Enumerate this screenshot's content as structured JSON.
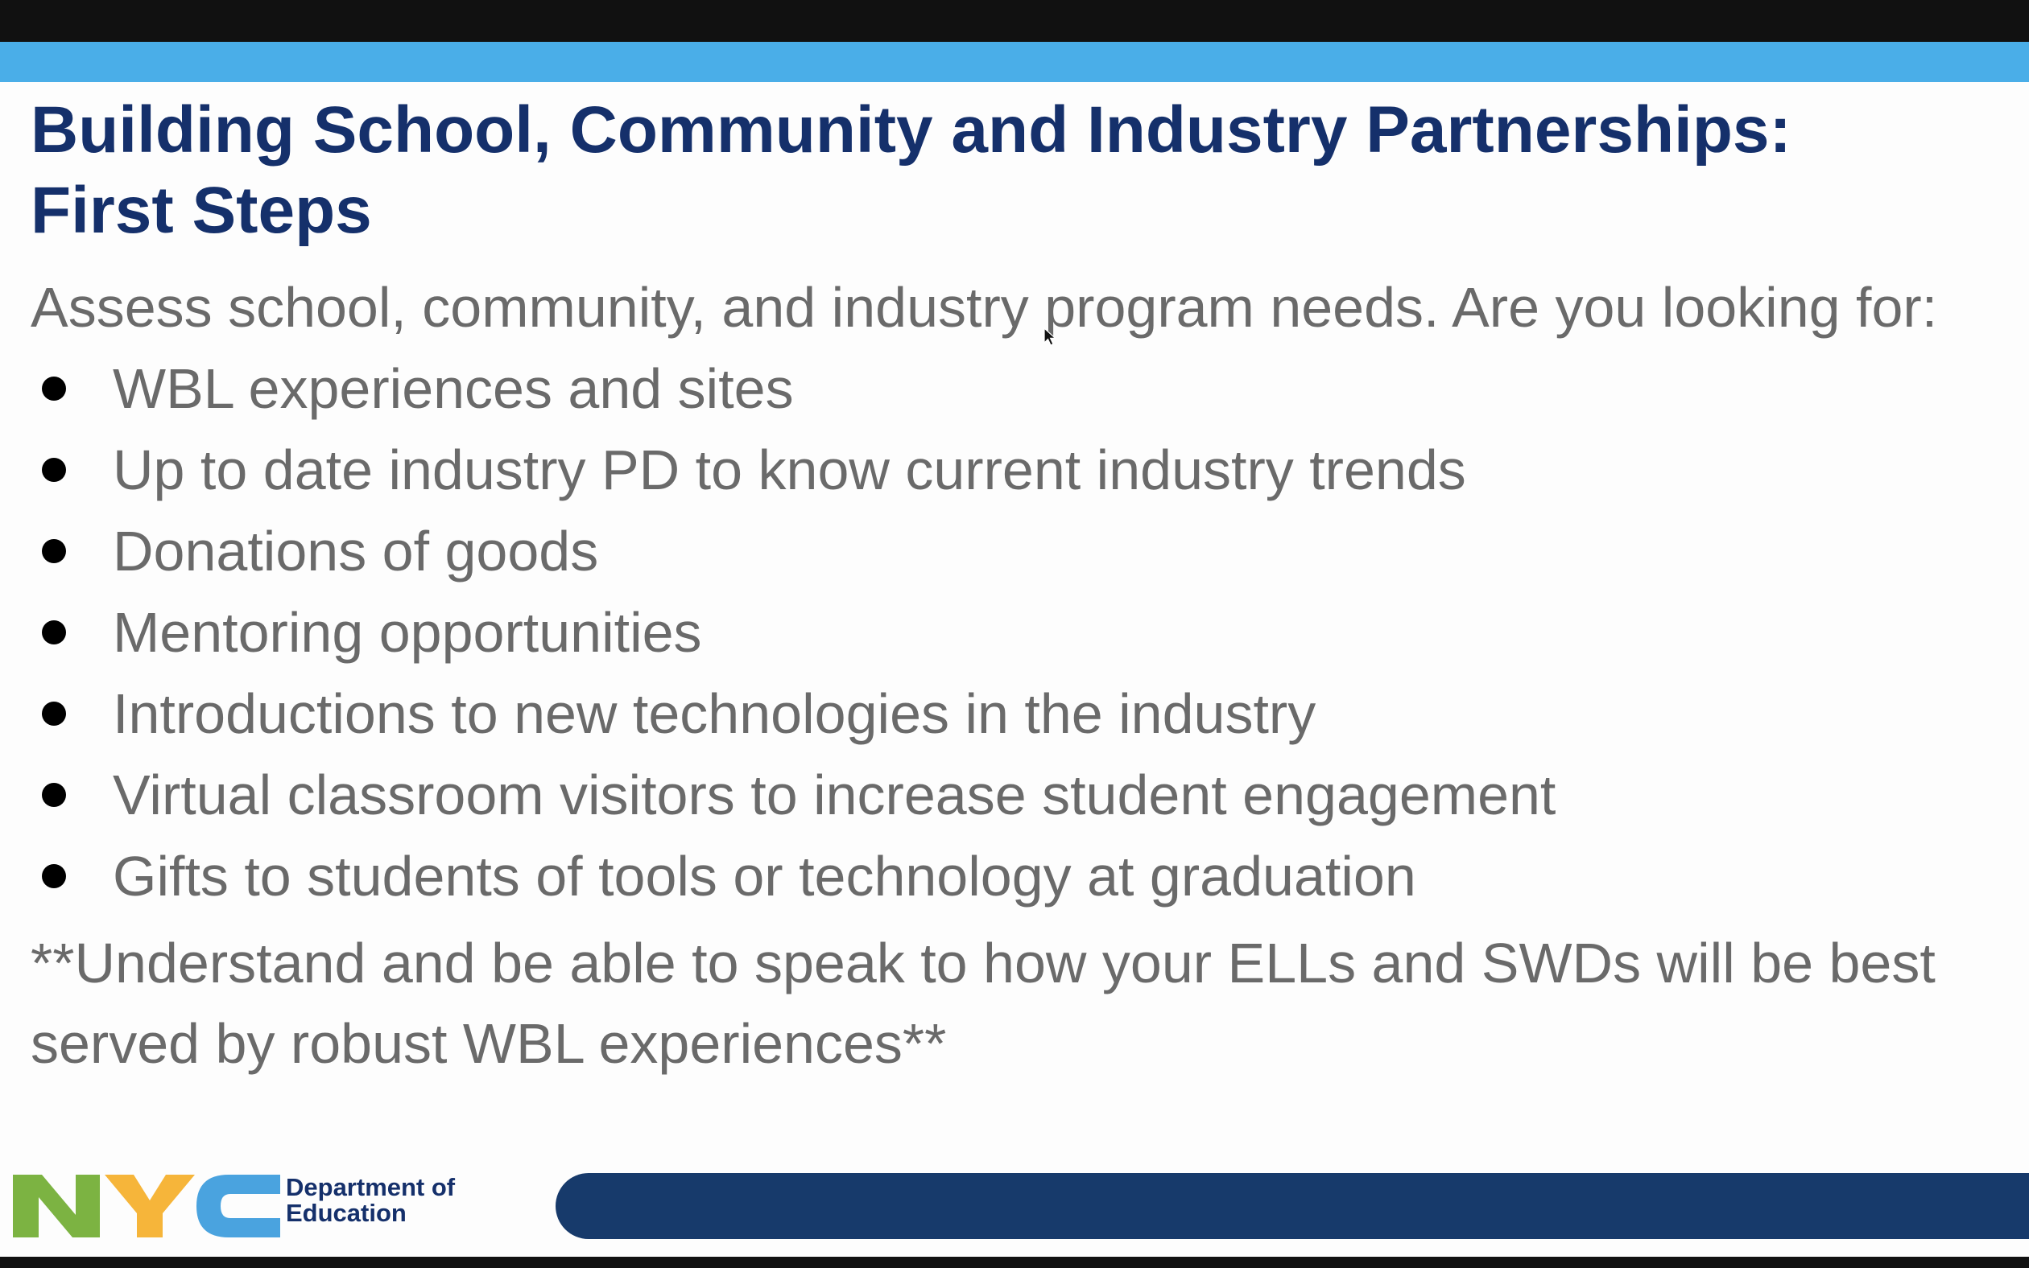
{
  "slide": {
    "title_line1": "Building School, Community and Industry Partnerships:",
    "title_line2": "First Steps",
    "intro": "Assess school, community, and industry program needs. Are you looking for:",
    "bullets": [
      "WBL experiences and sites",
      "Up to date industry PD to know current industry trends",
      "Donations of goods",
      "Mentoring opportunities",
      "Introductions to new technologies in the industry",
      "Virtual classroom visitors to increase student engagement",
      "Gifts to students of tools or technology at graduation"
    ],
    "note": "**Understand and be able to speak to how your ELLs and SWDs will be best served by robust WBL experiences**"
  },
  "footer": {
    "logo_letters": "NYC",
    "dept_line1": "Department of",
    "dept_line2": "Education"
  },
  "colors": {
    "accent_stripe": "#4aaee8",
    "title": "#15306b",
    "body_text": "#6a6a6a",
    "footer_bar": "#173a6b",
    "logo_green": "#7cb342",
    "logo_yellow": "#f6b53a",
    "logo_blue": "#4aa3df"
  },
  "icons": {
    "bullet": "filled-circle",
    "cursor": "mouse-pointer-icon"
  }
}
